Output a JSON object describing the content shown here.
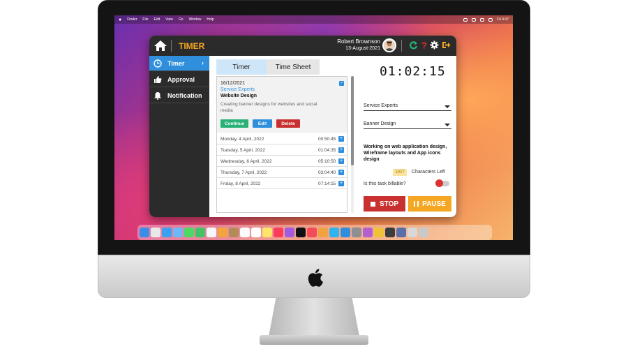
{
  "menubar": {
    "items": [
      "Finder",
      "File",
      "Edit",
      "View",
      "Go",
      "Window",
      "Help"
    ],
    "clock": "Fri 4:47"
  },
  "app": {
    "title": "TIMER",
    "user": {
      "name": "Robert Brownson",
      "date": "13-August-2021"
    },
    "header_icons": [
      "refresh-icon",
      "help-icon",
      "gear-icon",
      "logout-icon"
    ],
    "accent": "#f5a623",
    "primary": "#2f8fdc"
  },
  "sidebar": {
    "items": [
      {
        "label": "Timer",
        "icon": "clock-icon",
        "active": true
      },
      {
        "label": "Approval",
        "icon": "thumbs-up-icon",
        "active": false
      },
      {
        "label": "Notification",
        "icon": "bell-icon",
        "active": false
      }
    ]
  },
  "tabs": [
    {
      "label": "Timer",
      "active": true
    },
    {
      "label": "Time Sheet",
      "active": false
    }
  ],
  "entry": {
    "date": "16/12/2021",
    "client": "Service Experts",
    "project": "Website Design",
    "description": "Creating banner designs for websites and social media",
    "buttons": {
      "continue": "Continue",
      "edit": "Edit",
      "delete": "Delete"
    }
  },
  "logs": [
    {
      "date": "Monday, 4 April, 2022",
      "time": "00:50:45"
    },
    {
      "date": "Tuesday, 5 April, 2022",
      "time": "01:04:35"
    },
    {
      "date": "Wednesday, 6 April, 2022",
      "time": "05:10:50"
    },
    {
      "date": "Thursday, 7 April, 2022",
      "time": "03:04:40"
    },
    {
      "date": "Friday, 8 April, 2022",
      "time": "07:14:15"
    }
  ],
  "timer": {
    "clock": "01:02:15",
    "client_select": "Service Experts",
    "project_select": "Banner Design",
    "notes": "Working on web application design, Wireframe layouts and App icons design",
    "chars_left": "1927",
    "chars_label": "Characters Left",
    "billable_label": "Is this task billable?",
    "billable": false,
    "stop_label": "STOP",
    "pause_label": "PAUSE"
  }
}
